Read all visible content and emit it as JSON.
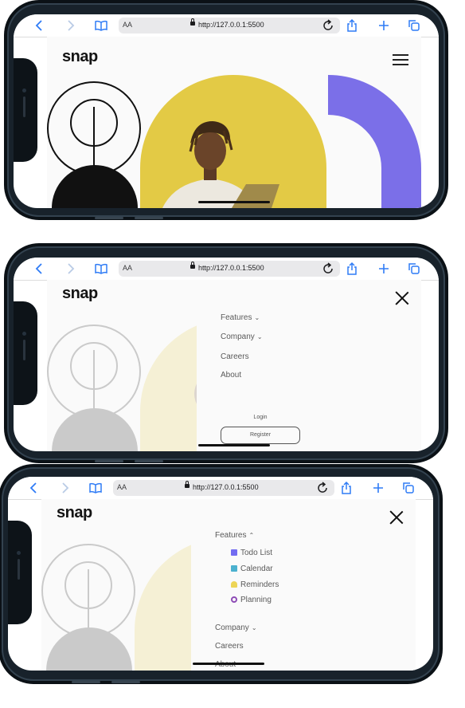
{
  "browser": {
    "aa_label": "AA",
    "url": "http://127.0.0.1:5500"
  },
  "brand": {
    "logo": "snap"
  },
  "colors": {
    "accent_purple": "#7b6fe8",
    "hero_yellow": "#e3ca45",
    "ios_blue": "#2f7cf6",
    "todo": "#726cf1",
    "calendar": "#4bb1cf",
    "reminders": "#edd556",
    "planning": "#8e4cb6"
  },
  "menu": {
    "features": "Features",
    "company": "Company",
    "careers": "Careers",
    "about": "About",
    "login": "Login",
    "register": "Register",
    "features_sub": [
      {
        "label": "Todo List",
        "icon": "todo-icon"
      },
      {
        "label": "Calendar",
        "icon": "calendar-icon"
      },
      {
        "label": "Reminders",
        "icon": "bell-icon"
      },
      {
        "label": "Planning",
        "icon": "planning-icon"
      }
    ]
  }
}
